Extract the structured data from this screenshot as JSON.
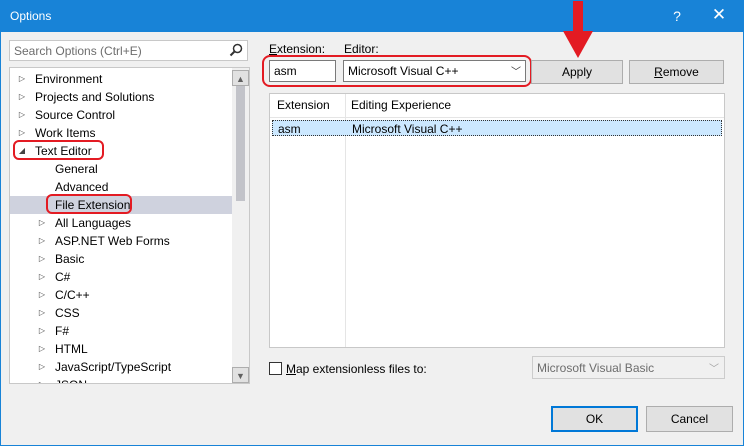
{
  "window": {
    "title": "Options",
    "help_glyph": "?",
    "close_glyph": "✕"
  },
  "search": {
    "placeholder": "Search Options (Ctrl+E)"
  },
  "tree": {
    "items": [
      {
        "label": "Environment",
        "level": 0,
        "expander": "collapsed"
      },
      {
        "label": "Projects and Solutions",
        "level": 0,
        "expander": "collapsed"
      },
      {
        "label": "Source Control",
        "level": 0,
        "expander": "collapsed"
      },
      {
        "label": "Work Items",
        "level": 0,
        "expander": "collapsed"
      },
      {
        "label": "Text Editor",
        "level": 0,
        "expander": "expanded"
      },
      {
        "label": "General",
        "level": 1,
        "expander": "none"
      },
      {
        "label": "Advanced",
        "level": 1,
        "expander": "none"
      },
      {
        "label": "File Extension",
        "level": 1,
        "expander": "none",
        "selected": true
      },
      {
        "label": "All Languages",
        "level": 1,
        "expander": "collapsed"
      },
      {
        "label": "ASP.NET Web Forms",
        "level": 1,
        "expander": "collapsed"
      },
      {
        "label": "Basic",
        "level": 1,
        "expander": "collapsed"
      },
      {
        "label": "C#",
        "level": 1,
        "expander": "collapsed"
      },
      {
        "label": "C/C++",
        "level": 1,
        "expander": "collapsed"
      },
      {
        "label": "CSS",
        "level": 1,
        "expander": "collapsed"
      },
      {
        "label": "F#",
        "level": 1,
        "expander": "collapsed"
      },
      {
        "label": "HTML",
        "level": 1,
        "expander": "collapsed"
      },
      {
        "label": "JavaScript/TypeScript",
        "level": 1,
        "expander": "collapsed"
      },
      {
        "label": "JSON",
        "level": 1,
        "expander": "collapsed"
      }
    ]
  },
  "extension": {
    "label": "Extension:",
    "value": "asm"
  },
  "editor": {
    "label": "Editor:",
    "value": "Microsoft Visual C++"
  },
  "buttons": {
    "apply": "Apply",
    "remove": "Remove",
    "ok": "OK",
    "cancel": "Cancel"
  },
  "grid": {
    "columns": [
      "Extension",
      "Editing Experience"
    ],
    "rows": [
      [
        "asm",
        "Microsoft Visual C++"
      ]
    ]
  },
  "map_extensionless": {
    "label": "Map extensionless files to:",
    "checked": false,
    "value": "Microsoft Visual Basic"
  },
  "colors": {
    "titlebar": "#1883d7",
    "highlight": "#e31b23",
    "selection": "#cce8ff",
    "tree_selection": "#cfd2de"
  }
}
